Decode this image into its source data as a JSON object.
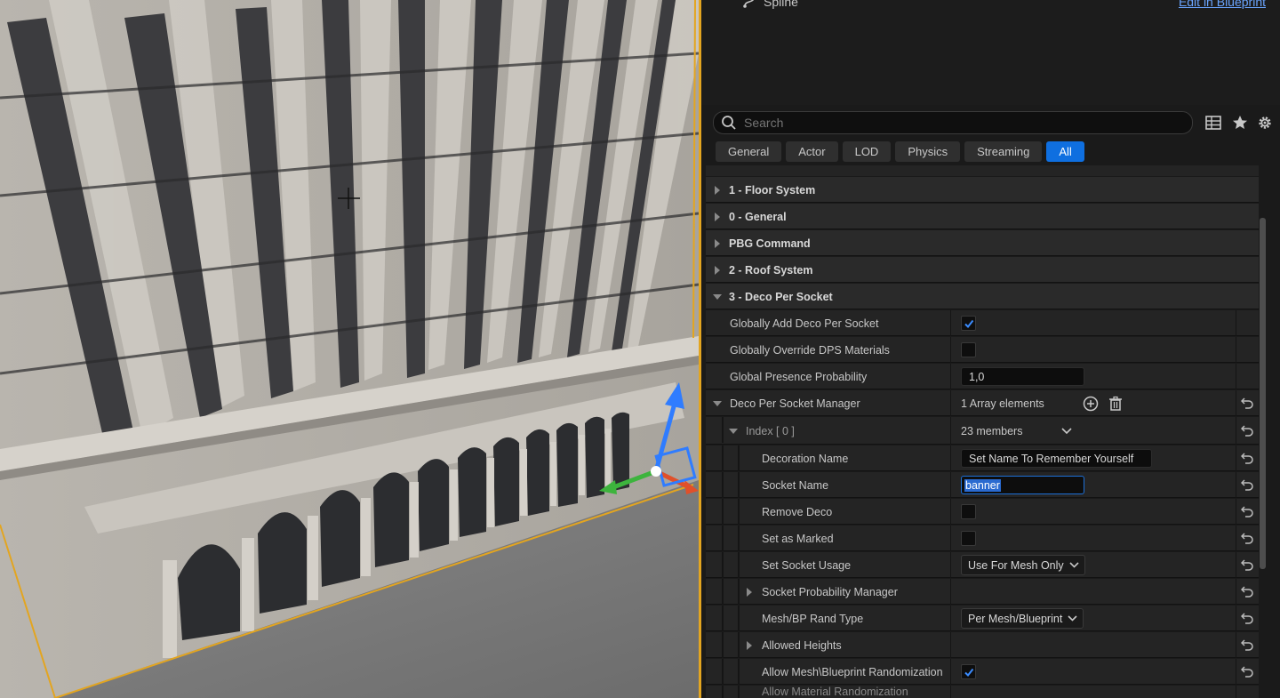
{
  "header": {
    "component_label": "Spline",
    "edit_link": "Edit in Blueprint"
  },
  "search": {
    "placeholder": "Search"
  },
  "filter_tabs": [
    "General",
    "Actor",
    "LOD",
    "Physics",
    "Streaming",
    "All"
  ],
  "active_tab": "All",
  "categories": {
    "floor": "1 - Floor System",
    "general": "0 - General",
    "pbg": "PBG Command",
    "roof": "2 - Roof System",
    "deco": "3 - Deco Per Socket"
  },
  "properties": {
    "globally_add_deco": {
      "label": "Globally Add Deco Per Socket",
      "checked": true
    },
    "globally_override_dps": {
      "label": "Globally Override DPS Materials",
      "checked": false
    },
    "global_presence": {
      "label": "Global Presence Probability",
      "value": "1,0"
    },
    "deco_manager": {
      "label": "Deco Per Socket Manager",
      "value": "1 Array elements"
    },
    "index": {
      "label": "Index [ 0 ]",
      "value": "23 members"
    },
    "decoration_name": {
      "label": "Decoration Name",
      "value": "Set Name To Remember Yourself"
    },
    "socket_name": {
      "label": "Socket Name",
      "value": "banner"
    },
    "remove_deco": {
      "label": "Remove Deco",
      "checked": false
    },
    "set_as_marked": {
      "label": "Set as Marked",
      "checked": false
    },
    "socket_usage": {
      "label": "Set Socket Usage",
      "value": "Use For Mesh Only"
    },
    "socket_probability": {
      "label": "Socket Probability Manager"
    },
    "rand_type": {
      "label": "Mesh/BP Rand Type",
      "value": "Per Mesh/Blueprint"
    },
    "allowed_heights": {
      "label": "Allowed Heights"
    },
    "allow_randomization": {
      "label": "Allow Mesh\\Blueprint Randomization",
      "checked": true
    },
    "cut_off_row": {
      "label": "Allow Material Randomization"
    }
  },
  "colors": {
    "accent": "#0f6fe0",
    "selection_outline": "#e3a520",
    "link": "#6aa5ff"
  }
}
